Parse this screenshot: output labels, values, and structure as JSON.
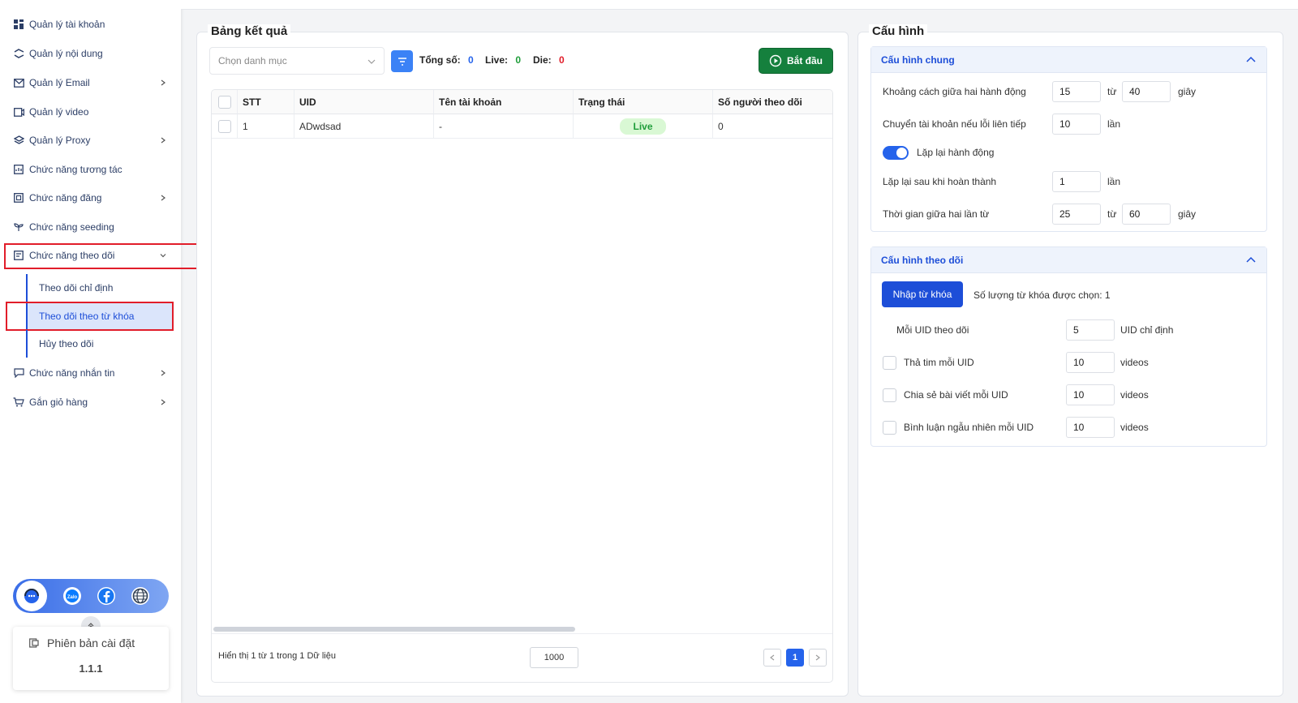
{
  "sidebar": {
    "items": [
      {
        "label": "Quản lý tài khoản",
        "icon": "grid-icon",
        "chevron": false
      },
      {
        "label": "Quản lý nội dung",
        "icon": "content-icon",
        "chevron": false
      },
      {
        "label": "Quản lý Email",
        "icon": "email-icon",
        "chevron": true
      },
      {
        "label": "Quản lý video",
        "icon": "video-icon",
        "chevron": false
      },
      {
        "label": "Quản lý Proxy",
        "icon": "layers-icon",
        "chevron": true
      },
      {
        "label": "Chức năng tương tác",
        "icon": "interact-icon",
        "chevron": false
      },
      {
        "label": "Chức năng đăng",
        "icon": "post-icon",
        "chevron": true
      },
      {
        "label": "Chức năng seeding",
        "icon": "seed-icon",
        "chevron": false
      },
      {
        "label": "Chức năng theo dõi",
        "icon": "follow-icon",
        "chevron": true
      },
      {
        "label": "Chức năng nhắn tin",
        "icon": "chat-icon",
        "chevron": true
      },
      {
        "label": "Gắn giỏ hàng",
        "icon": "cart-icon",
        "chevron": true
      }
    ],
    "subitems": [
      {
        "label": "Theo dõi chỉ định"
      },
      {
        "label": "Theo dõi theo từ khóa"
      },
      {
        "label": "Hủy theo dõi"
      }
    ],
    "version_label": "Phiên bản cài đặt",
    "version_value": "1.1.1"
  },
  "results": {
    "title": "Bảng kết quả",
    "category_placeholder": "Chọn danh mục",
    "total_label": "Tổng số:",
    "total_value": "0",
    "live_label": "Live:",
    "live_value": "0",
    "die_label": "Die:",
    "die_value": "0",
    "start_label": "Bắt đầu",
    "columns": [
      "STT",
      "UID",
      "Tên tài khoản",
      "Trạng thái",
      "Số người theo dõi"
    ],
    "rows": [
      {
        "stt": "1",
        "uid": "ADwdsad",
        "name": "-",
        "status": "Live",
        "followers": "0"
      }
    ],
    "footer_text": "Hiển thị 1 từ 1 trong 1 Dữ liệu",
    "page_size": "1000",
    "current_page": "1"
  },
  "config": {
    "title": "Cấu hình",
    "general": {
      "title": "Cấu hình chung",
      "delay_label": "Khoảng cách giữa hai hành động",
      "delay_from": "15",
      "delay_sep": "từ",
      "delay_to": "40",
      "delay_unit": "giây",
      "switch_label": "Chuyển tài khoản nếu lỗi liên tiếp",
      "switch_value": "10",
      "switch_unit": "lần",
      "repeat_label": "Lặp lại hành động",
      "repeat_after_label": "Lặp lại sau khi hoàn thành",
      "repeat_after_value": "1",
      "repeat_after_unit": "lần",
      "interval_label": "Thời gian giữa hai lần từ",
      "interval_from": "25",
      "interval_sep": "từ",
      "interval_to": "60",
      "interval_unit": "giây"
    },
    "follow": {
      "title": "Cấu hình theo dõi",
      "import_label": "Nhập từ khóa",
      "selected_label": "Số lượng từ khóa được chọn: 1",
      "per_uid_label": "Mỗi UID theo dõi",
      "per_uid_value": "5",
      "per_uid_unit": "UID chỉ định",
      "like_label": "Thả tim mỗi UID",
      "like_value": "10",
      "like_unit": "videos",
      "share_label": "Chia sẻ bài viết mỗi UID",
      "share_value": "10",
      "share_unit": "videos",
      "comment_label": "Bình luận ngẫu nhiên mỗi UID",
      "comment_value": "10",
      "comment_unit": "videos"
    }
  },
  "colors": {
    "primary": "#1d4ed8",
    "live": "#1f9d3a",
    "die": "#e11d2a",
    "start": "#15803d"
  }
}
